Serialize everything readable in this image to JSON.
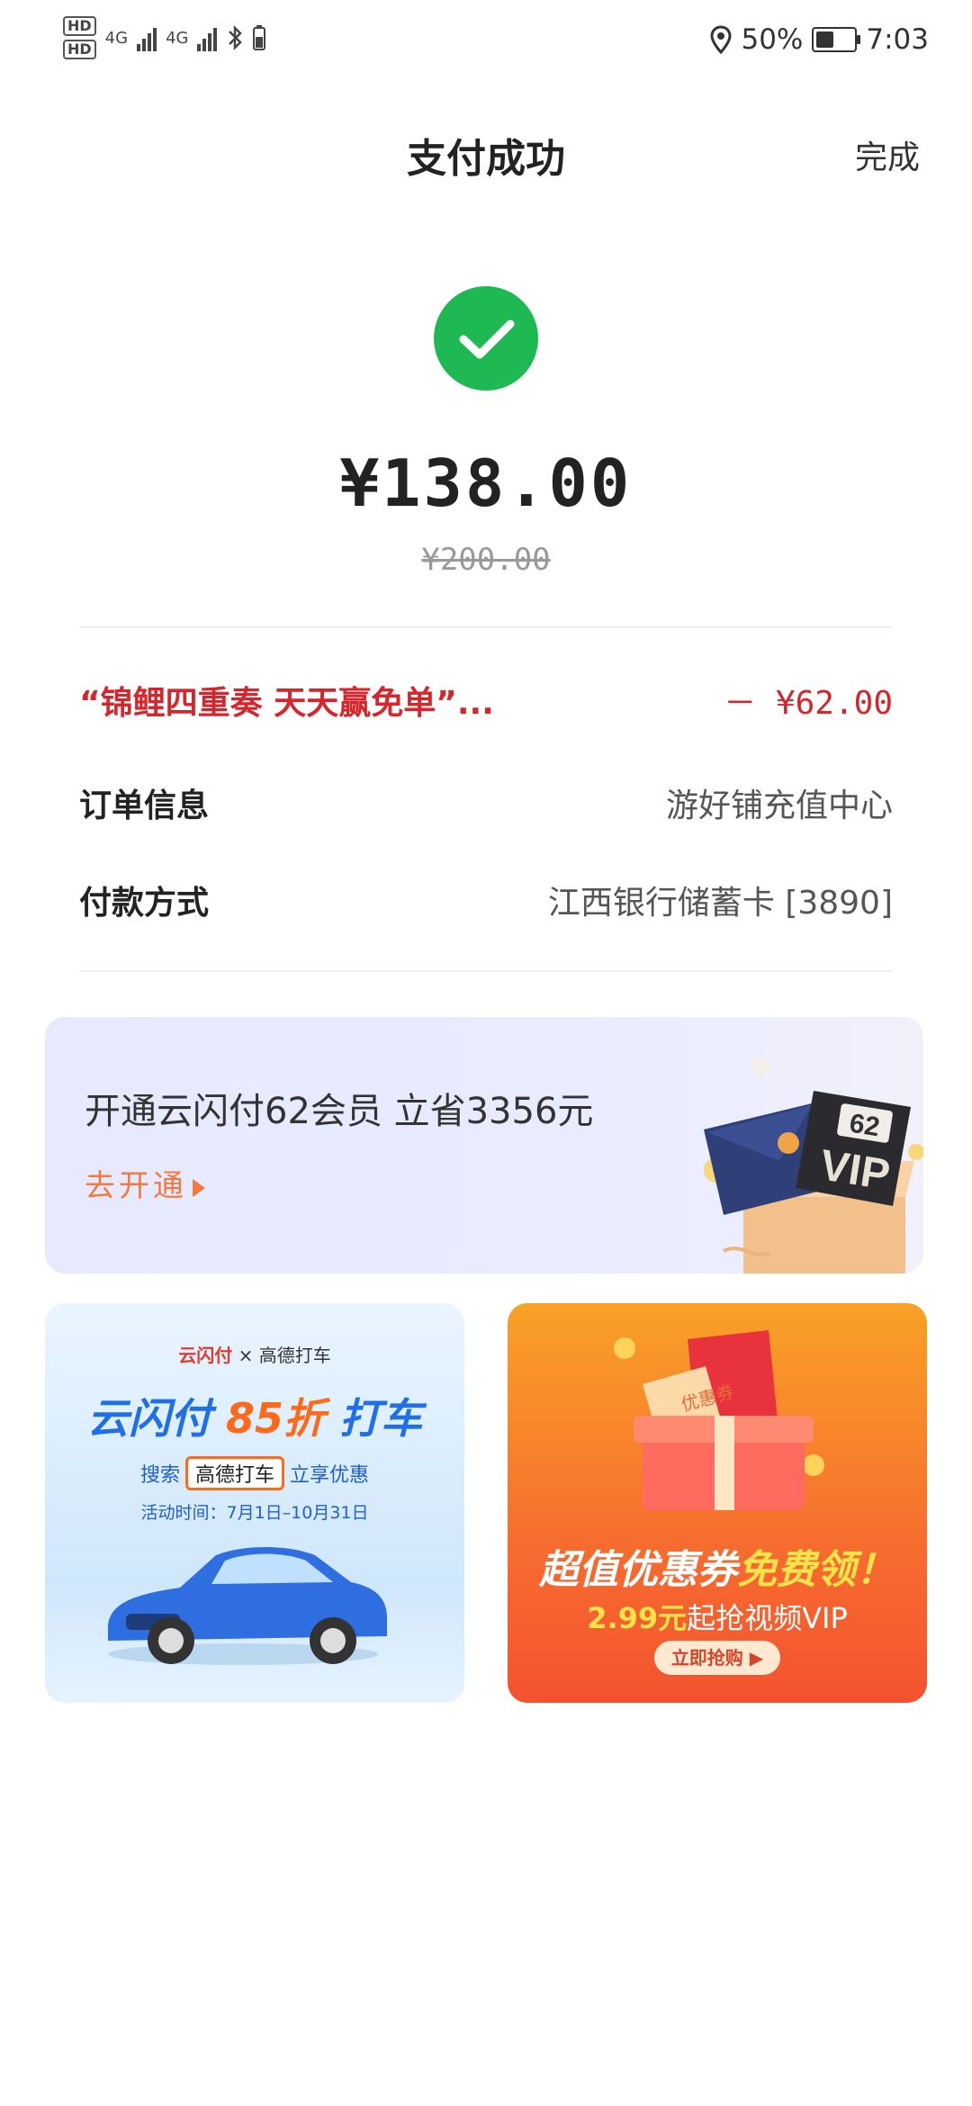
{
  "status_bar": {
    "hd1": "HD",
    "hd2": "HD",
    "net1": "4G",
    "net2": "4G",
    "battery_percent": "50%",
    "battery_level": 0.5,
    "time": "7:03"
  },
  "header": {
    "title": "支付成功",
    "done_label": "完成"
  },
  "payment": {
    "amount": "¥138.00",
    "original_amount": "¥200.00",
    "success_color": "#1fb954"
  },
  "details": {
    "promo_label": "“锦鲤四重奏 天天赢免单”...",
    "promo_value": "－ ¥62.00",
    "order_label": "订单信息",
    "order_value": "游好铺充值中心",
    "method_label": "付款方式",
    "method_value": "江西银行储蓄卡 [3890]"
  },
  "vip_banner": {
    "title": "开通云闪付62会员 立省3356元",
    "link": "去开通",
    "badge_num": "62",
    "badge_text": "VIP"
  },
  "ad_left": {
    "brand1": "云闪付",
    "times": "×",
    "brand2": "高德打车",
    "head_a": "云闪付 ",
    "head_num": "85折",
    "head_b": " 打车",
    "search_a": "搜索",
    "search_box": "高德打车",
    "search_b": "立享优惠",
    "date": "活动时间：7月1日–10月31日"
  },
  "ad_right": {
    "title_a": "超值优惠券",
    "title_b": "免费领！",
    "sub_num": "2.99元",
    "sub_text": "起抢视频VIP",
    "button": "立即抢购",
    "ticket_text": "优惠券"
  }
}
